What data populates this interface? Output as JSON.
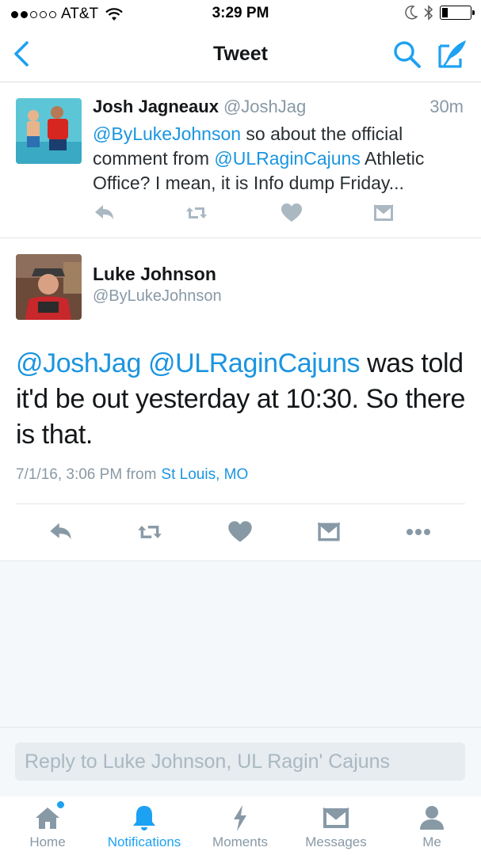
{
  "status_bar": {
    "carrier": "AT&T",
    "time": "3:29 PM",
    "signal_bars_filled": 2,
    "signal_bars_total": 5,
    "battery_level": 0.2,
    "icons": [
      "wifi-icon",
      "moon-icon",
      "bluetooth-icon",
      "battery-icon"
    ]
  },
  "nav": {
    "title": "Tweet",
    "icons": [
      "back-chevron-icon",
      "search-icon",
      "compose-icon"
    ]
  },
  "parent_tweet": {
    "name": "Josh Jagneaux",
    "handle": "@JoshJag",
    "time": "30m",
    "text_parts": {
      "mention1": "@ByLukeJohnson",
      "t1": " so about the official comment from ",
      "mention2": "@ULRaginCajuns",
      "t2": " Athletic Office? I mean, it is Info dump Friday..."
    },
    "actions": [
      "reply-icon",
      "retweet-icon",
      "like-icon",
      "message-icon"
    ]
  },
  "main_tweet": {
    "name": "Luke Johnson",
    "handle": "@ByLukeJohnson",
    "text_parts": {
      "mention1": "@JoshJag",
      "sep": " ",
      "mention2": "@ULRaginCajuns",
      "t1": " was told it'd be out yesterday at 10:30. So there is that."
    },
    "timestamp": "7/1/16, 3:06 PM from",
    "location": "St Louis, MO",
    "actions": [
      "reply-icon",
      "retweet-icon",
      "like-icon",
      "message-icon",
      "more-icon"
    ]
  },
  "reply": {
    "placeholder": "Reply to Luke Johnson, UL Ragin' Cajuns"
  },
  "tabs": [
    {
      "label": "Home",
      "icon": "home-icon",
      "active": false,
      "has_dot": true
    },
    {
      "label": "Notifications",
      "icon": "bell-icon",
      "active": true,
      "has_dot": false
    },
    {
      "label": "Moments",
      "icon": "lightning-icon",
      "active": false,
      "has_dot": false
    },
    {
      "label": "Messages",
      "icon": "envelope-icon",
      "active": false,
      "has_dot": false
    },
    {
      "label": "Me",
      "icon": "person-icon",
      "active": false,
      "has_dot": false
    }
  ],
  "colors": {
    "accent": "#1da1f2",
    "link": "#1b95e0",
    "icon_gray": "#aab8c2",
    "text_secondary": "#8899a6"
  }
}
